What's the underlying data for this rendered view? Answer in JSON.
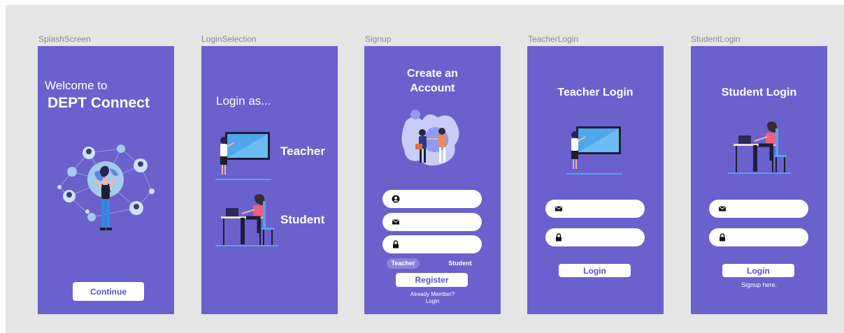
{
  "frames": {
    "splash": {
      "label": "SplashScreen",
      "welcome": "Welcome to",
      "app_name": "DEPT Connect",
      "continue_label": "Continue"
    },
    "selection": {
      "label": "LoginSelection",
      "title": "Login as...",
      "teacher_label": "Teacher",
      "student_label": "Student"
    },
    "signup": {
      "label": "Signup",
      "title_line1": "Create an",
      "title_line2": "Account",
      "role_teacher": "Teacher",
      "role_student": "Student",
      "register_label": "Register",
      "footer_line1": "Already Member?",
      "footer_line2": "Login"
    },
    "teacher_login": {
      "label": "TeacherLogin",
      "title": "Teacher Login",
      "login_label": "Login"
    },
    "student_login": {
      "label": "StudentLogin",
      "title": "Student Login",
      "login_label": "Login",
      "signup_link": "Signup here."
    }
  },
  "icons": {
    "user": "user-icon",
    "mail": "mail-icon",
    "lock": "lock-icon"
  },
  "colors": {
    "frame_bg": "#6a61cd",
    "canvas_bg": "#e5e5e5",
    "accent": "#5a51c0",
    "selected_role": "#8a82d9"
  }
}
